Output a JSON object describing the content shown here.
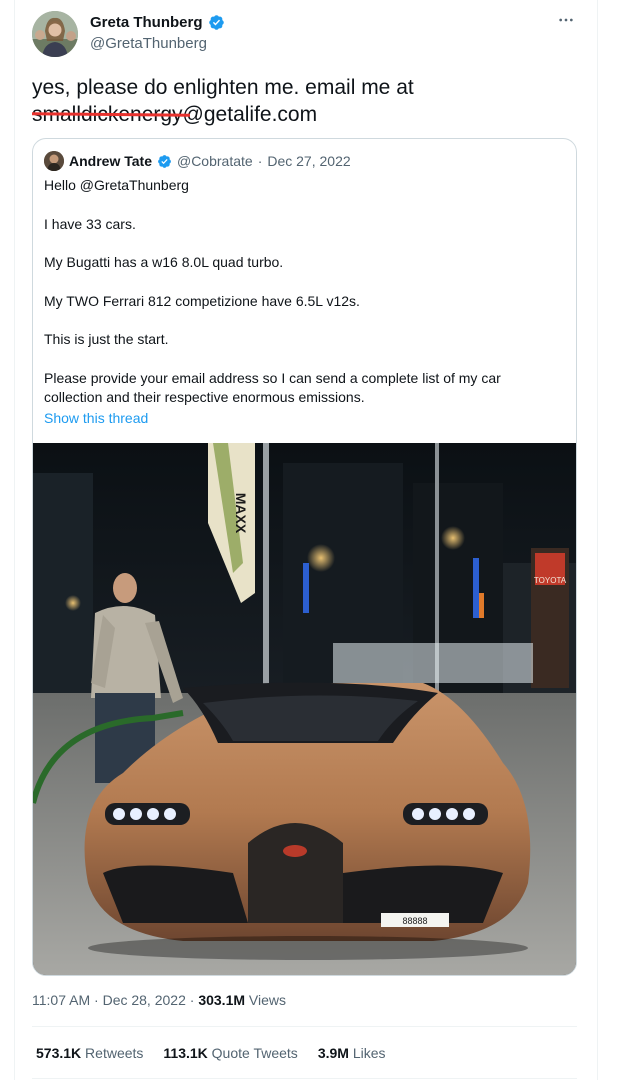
{
  "author": {
    "display_name": "Greta Thunberg",
    "handle": "@GretaThunberg"
  },
  "more_icon": "more-horizontal-icon",
  "tweet": {
    "text_line1": "yes, please do enlighten me. email me at",
    "email": "smalldickenergy@getalife.com"
  },
  "quoted": {
    "display_name": "Andrew Tate",
    "handle": "@Cobratate",
    "separator": "·",
    "date": "Dec 27, 2022",
    "lines": [
      "Hello @GretaThunberg",
      "I have 33 cars.",
      "My Bugatti has a w16 8.0L quad turbo.",
      "My TWO Ferrari 812 competizione have 6.5L v12s.",
      "This is just the start.",
      "Please provide your email address so I can send a complete list of my car collection and their respective enormous emissions."
    ],
    "show_thread": "Show this thread",
    "photo_signs": {
      "banner": "MAXX",
      "dealer": "TOYOTA",
      "plate": "88888"
    }
  },
  "meta": {
    "time": "11:07 AM",
    "separator": "·",
    "date": "Dec 28, 2022",
    "views_count": "303.1M",
    "views_label": "Views"
  },
  "stats": {
    "retweets_count": "573.1K",
    "retweets_label": "Retweets",
    "quotes_count": "113.1K",
    "quotes_label": "Quote Tweets",
    "likes_count": "3.9M",
    "likes_label": "Likes"
  },
  "colors": {
    "verified": "#1d9bf0",
    "link": "#1d9bf0",
    "strike": "#e8322e",
    "secondary_text": "#536471"
  }
}
